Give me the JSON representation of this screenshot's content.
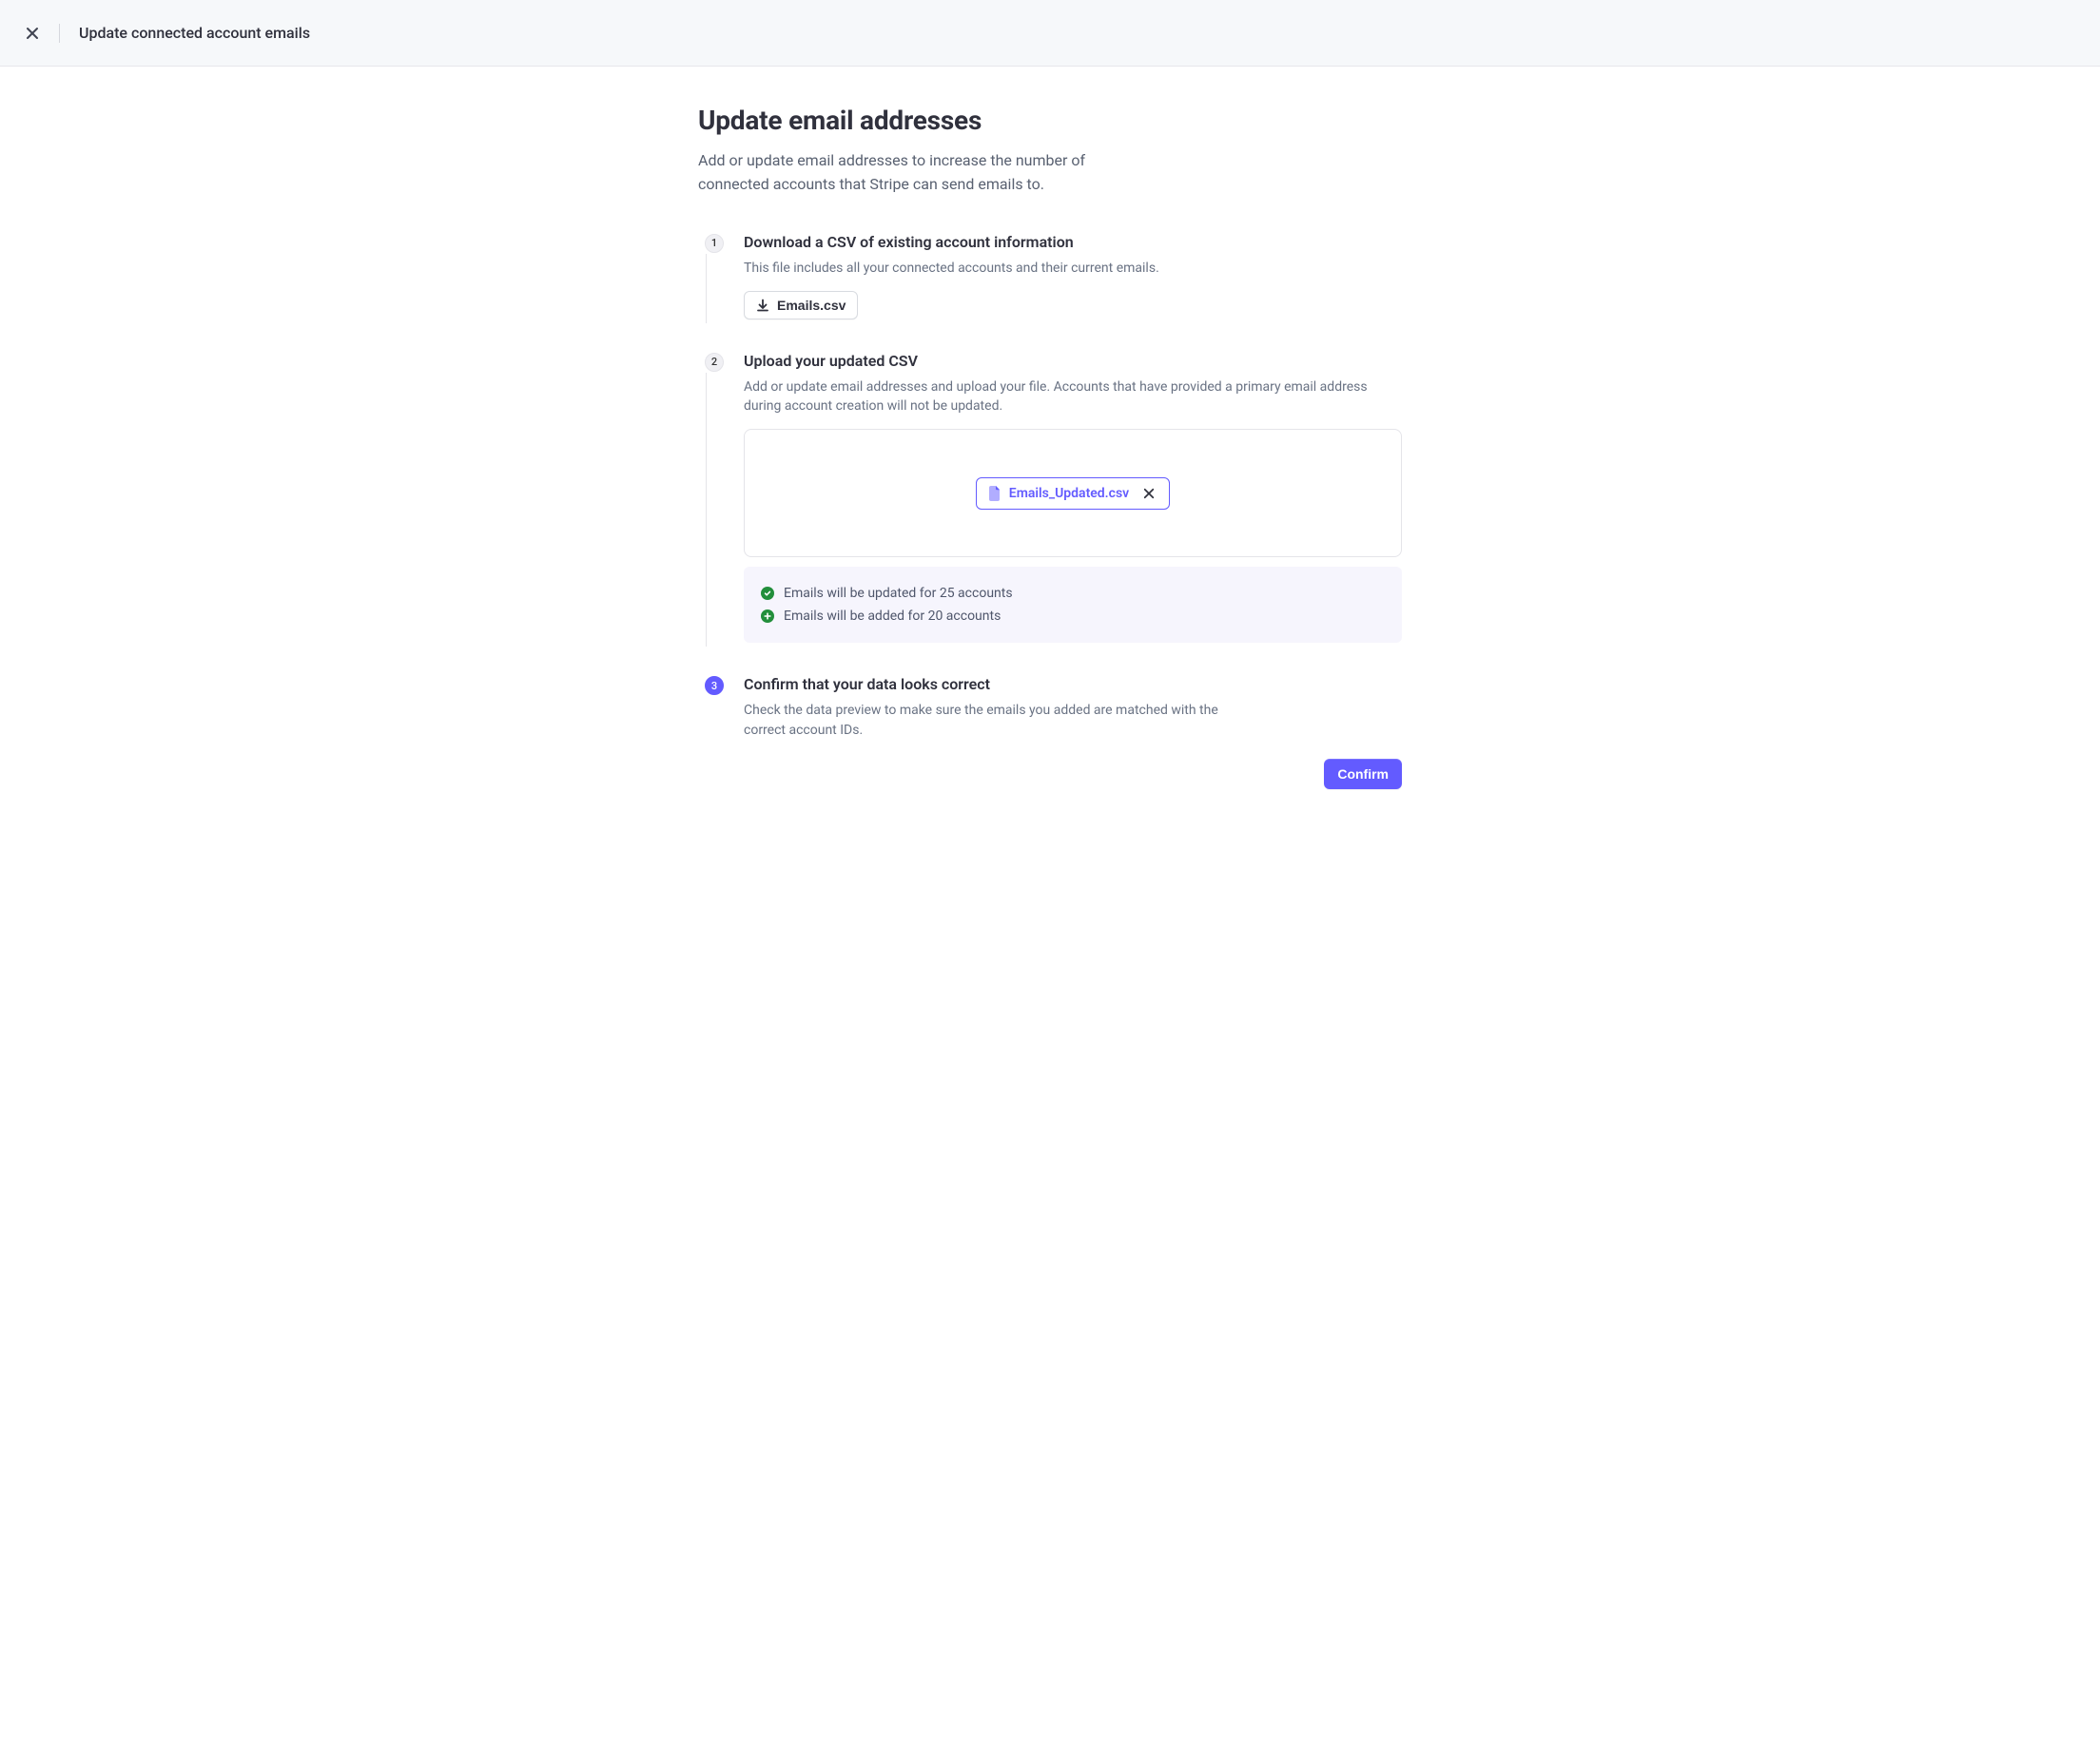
{
  "header": {
    "title": "Update connected account emails"
  },
  "page": {
    "title": "Update email addresses",
    "description": "Add or update email addresses to increase the number of connected accounts that Stripe can send emails to."
  },
  "steps": {
    "s1": {
      "num": "1",
      "title": "Download a CSV of existing account information",
      "desc": "This file includes all your connected accounts and their current emails.",
      "download_label": "Emails.csv"
    },
    "s2": {
      "num": "2",
      "title": "Upload your updated CSV",
      "desc": "Add or update email addresses and upload your file. Accounts that have provided a primary email address during account creation will not be updated.",
      "uploaded_file": "Emails_Updated.csv",
      "result_updated": "Emails will be updated for 25 accounts",
      "result_added": "Emails will be added for 20 accounts"
    },
    "s3": {
      "num": "3",
      "title": "Confirm that your data looks correct",
      "desc": "Check the data preview to make sure the emails you added are matched with the correct account IDs.",
      "confirm_label": "Confirm"
    }
  }
}
